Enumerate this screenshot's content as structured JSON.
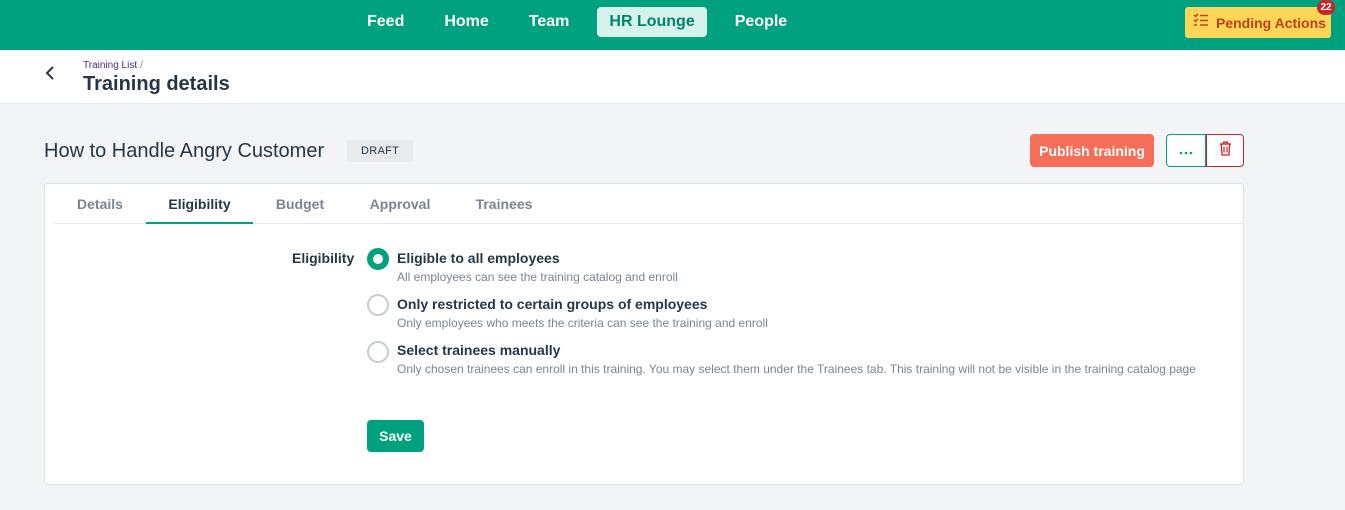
{
  "nav": {
    "items": [
      {
        "label": "Feed",
        "active": false
      },
      {
        "label": "Home",
        "active": false
      },
      {
        "label": "Team",
        "active": false
      },
      {
        "label": "HR Lounge",
        "active": true
      },
      {
        "label": "People",
        "active": false
      }
    ],
    "pending_actions": {
      "label": "Pending Actions",
      "count": "22",
      "icon": "checklist-icon"
    }
  },
  "header": {
    "back_icon": "chevron-left-icon",
    "breadcrumb": "Training List",
    "breadcrumb_separator": "/",
    "title": "Training details"
  },
  "training": {
    "name": "How to Handle Angry Customer",
    "status": "DRAFT",
    "publish_label": "Publish training",
    "more_icon": "ellipsis-icon",
    "delete_icon": "trash-icon"
  },
  "tabs": [
    {
      "label": "Details",
      "active": false
    },
    {
      "label": "Eligibility",
      "active": true
    },
    {
      "label": "Budget",
      "active": false
    },
    {
      "label": "Approval",
      "active": false
    },
    {
      "label": "Trainees",
      "active": false
    }
  ],
  "eligibility": {
    "label": "Eligibility",
    "options": [
      {
        "title": "Eligible to all employees",
        "desc": "All employees can see the training catalog and enroll",
        "selected": true
      },
      {
        "title": "Only restricted to certain groups of employees",
        "desc": "Only employees who meets the criteria can see the training and enroll",
        "selected": false
      },
      {
        "title": "Select trainees manually",
        "desc": "Only chosen trainees can enroll in this training. You may select them under the Trainees tab. This training will not be visible in the training catalog page",
        "selected": false
      }
    ],
    "save_label": "Save"
  },
  "colors": {
    "brand": "#00a17e",
    "publish": "#f56e58",
    "pending": "#fdd557",
    "danger": "#c3262d"
  }
}
